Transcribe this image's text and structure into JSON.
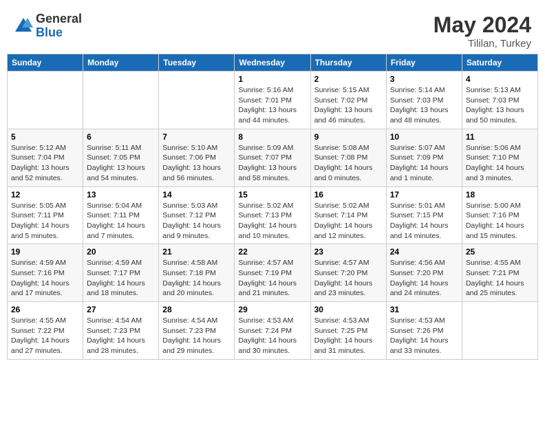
{
  "header": {
    "logo_general": "General",
    "logo_blue": "Blue",
    "month_year": "May 2024",
    "location": "Tililan, Turkey"
  },
  "weekdays": [
    "Sunday",
    "Monday",
    "Tuesday",
    "Wednesday",
    "Thursday",
    "Friday",
    "Saturday"
  ],
  "weeks": [
    [
      {
        "day": "",
        "sunrise": "",
        "sunset": "",
        "daylight": ""
      },
      {
        "day": "",
        "sunrise": "",
        "sunset": "",
        "daylight": ""
      },
      {
        "day": "",
        "sunrise": "",
        "sunset": "",
        "daylight": ""
      },
      {
        "day": "1",
        "sunrise": "Sunrise: 5:16 AM",
        "sunset": "Sunset: 7:01 PM",
        "daylight": "Daylight: 13 hours and 44 minutes."
      },
      {
        "day": "2",
        "sunrise": "Sunrise: 5:15 AM",
        "sunset": "Sunset: 7:02 PM",
        "daylight": "Daylight: 13 hours and 46 minutes."
      },
      {
        "day": "3",
        "sunrise": "Sunrise: 5:14 AM",
        "sunset": "Sunset: 7:03 PM",
        "daylight": "Daylight: 13 hours and 48 minutes."
      },
      {
        "day": "4",
        "sunrise": "Sunrise: 5:13 AM",
        "sunset": "Sunset: 7:03 PM",
        "daylight": "Daylight: 13 hours and 50 minutes."
      }
    ],
    [
      {
        "day": "5",
        "sunrise": "Sunrise: 5:12 AM",
        "sunset": "Sunset: 7:04 PM",
        "daylight": "Daylight: 13 hours and 52 minutes."
      },
      {
        "day": "6",
        "sunrise": "Sunrise: 5:11 AM",
        "sunset": "Sunset: 7:05 PM",
        "daylight": "Daylight: 13 hours and 54 minutes."
      },
      {
        "day": "7",
        "sunrise": "Sunrise: 5:10 AM",
        "sunset": "Sunset: 7:06 PM",
        "daylight": "Daylight: 13 hours and 56 minutes."
      },
      {
        "day": "8",
        "sunrise": "Sunrise: 5:09 AM",
        "sunset": "Sunset: 7:07 PM",
        "daylight": "Daylight: 13 hours and 58 minutes."
      },
      {
        "day": "9",
        "sunrise": "Sunrise: 5:08 AM",
        "sunset": "Sunset: 7:08 PM",
        "daylight": "Daylight: 14 hours and 0 minutes."
      },
      {
        "day": "10",
        "sunrise": "Sunrise: 5:07 AM",
        "sunset": "Sunset: 7:09 PM",
        "daylight": "Daylight: 14 hours and 1 minute."
      },
      {
        "day": "11",
        "sunrise": "Sunrise: 5:06 AM",
        "sunset": "Sunset: 7:10 PM",
        "daylight": "Daylight: 14 hours and 3 minutes."
      }
    ],
    [
      {
        "day": "12",
        "sunrise": "Sunrise: 5:05 AM",
        "sunset": "Sunset: 7:11 PM",
        "daylight": "Daylight: 14 hours and 5 minutes."
      },
      {
        "day": "13",
        "sunrise": "Sunrise: 5:04 AM",
        "sunset": "Sunset: 7:11 PM",
        "daylight": "Daylight: 14 hours and 7 minutes."
      },
      {
        "day": "14",
        "sunrise": "Sunrise: 5:03 AM",
        "sunset": "Sunset: 7:12 PM",
        "daylight": "Daylight: 14 hours and 9 minutes."
      },
      {
        "day": "15",
        "sunrise": "Sunrise: 5:02 AM",
        "sunset": "Sunset: 7:13 PM",
        "daylight": "Daylight: 14 hours and 10 minutes."
      },
      {
        "day": "16",
        "sunrise": "Sunrise: 5:02 AM",
        "sunset": "Sunset: 7:14 PM",
        "daylight": "Daylight: 14 hours and 12 minutes."
      },
      {
        "day": "17",
        "sunrise": "Sunrise: 5:01 AM",
        "sunset": "Sunset: 7:15 PM",
        "daylight": "Daylight: 14 hours and 14 minutes."
      },
      {
        "day": "18",
        "sunrise": "Sunrise: 5:00 AM",
        "sunset": "Sunset: 7:16 PM",
        "daylight": "Daylight: 14 hours and 15 minutes."
      }
    ],
    [
      {
        "day": "19",
        "sunrise": "Sunrise: 4:59 AM",
        "sunset": "Sunset: 7:16 PM",
        "daylight": "Daylight: 14 hours and 17 minutes."
      },
      {
        "day": "20",
        "sunrise": "Sunrise: 4:59 AM",
        "sunset": "Sunset: 7:17 PM",
        "daylight": "Daylight: 14 hours and 18 minutes."
      },
      {
        "day": "21",
        "sunrise": "Sunrise: 4:58 AM",
        "sunset": "Sunset: 7:18 PM",
        "daylight": "Daylight: 14 hours and 20 minutes."
      },
      {
        "day": "22",
        "sunrise": "Sunrise: 4:57 AM",
        "sunset": "Sunset: 7:19 PM",
        "daylight": "Daylight: 14 hours and 21 minutes."
      },
      {
        "day": "23",
        "sunrise": "Sunrise: 4:57 AM",
        "sunset": "Sunset: 7:20 PM",
        "daylight": "Daylight: 14 hours and 23 minutes."
      },
      {
        "day": "24",
        "sunrise": "Sunrise: 4:56 AM",
        "sunset": "Sunset: 7:20 PM",
        "daylight": "Daylight: 14 hours and 24 minutes."
      },
      {
        "day": "25",
        "sunrise": "Sunrise: 4:55 AM",
        "sunset": "Sunset: 7:21 PM",
        "daylight": "Daylight: 14 hours and 25 minutes."
      }
    ],
    [
      {
        "day": "26",
        "sunrise": "Sunrise: 4:55 AM",
        "sunset": "Sunset: 7:22 PM",
        "daylight": "Daylight: 14 hours and 27 minutes."
      },
      {
        "day": "27",
        "sunrise": "Sunrise: 4:54 AM",
        "sunset": "Sunset: 7:23 PM",
        "daylight": "Daylight: 14 hours and 28 minutes."
      },
      {
        "day": "28",
        "sunrise": "Sunrise: 4:54 AM",
        "sunset": "Sunset: 7:23 PM",
        "daylight": "Daylight: 14 hours and 29 minutes."
      },
      {
        "day": "29",
        "sunrise": "Sunrise: 4:53 AM",
        "sunset": "Sunset: 7:24 PM",
        "daylight": "Daylight: 14 hours and 30 minutes."
      },
      {
        "day": "30",
        "sunrise": "Sunrise: 4:53 AM",
        "sunset": "Sunset: 7:25 PM",
        "daylight": "Daylight: 14 hours and 31 minutes."
      },
      {
        "day": "31",
        "sunrise": "Sunrise: 4:53 AM",
        "sunset": "Sunset: 7:26 PM",
        "daylight": "Daylight: 14 hours and 33 minutes."
      },
      {
        "day": "",
        "sunrise": "",
        "sunset": "",
        "daylight": ""
      }
    ]
  ]
}
